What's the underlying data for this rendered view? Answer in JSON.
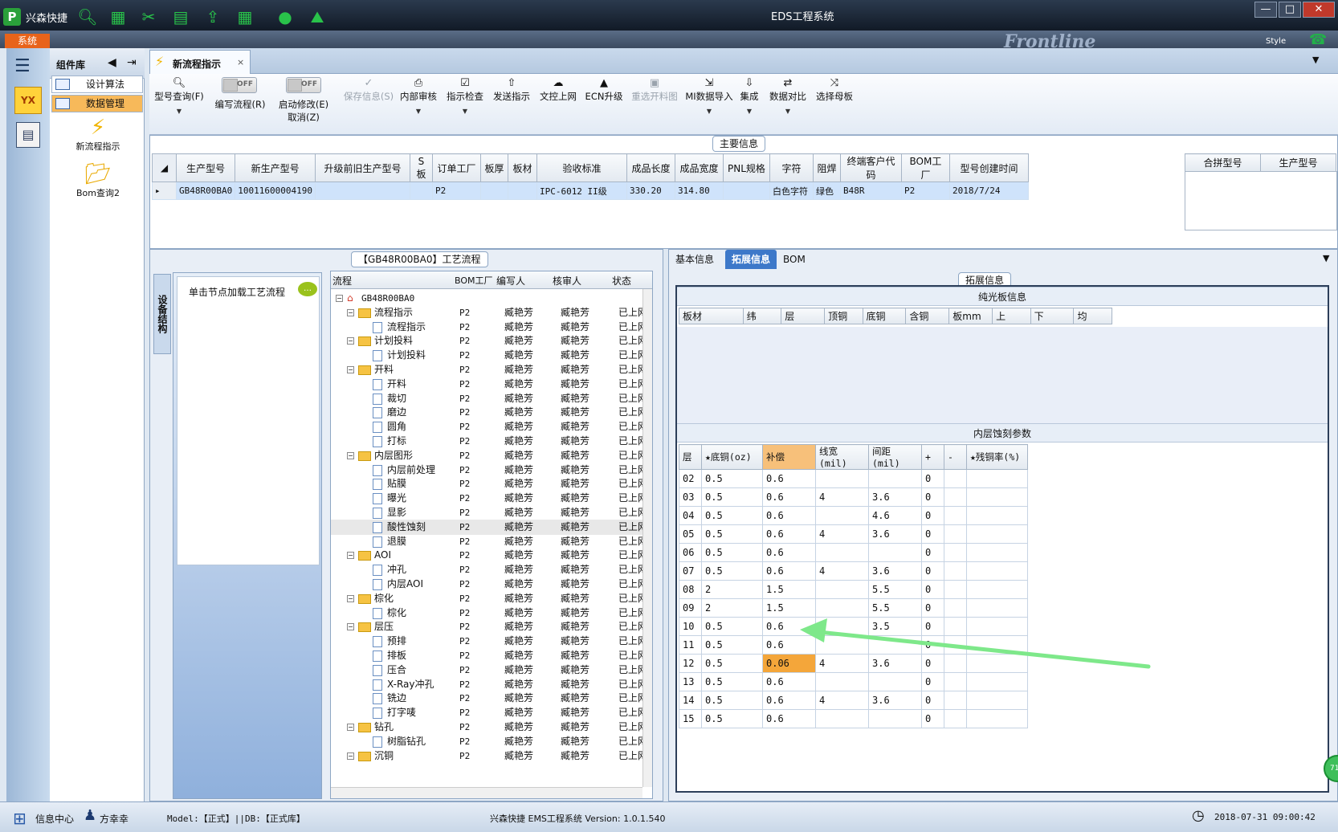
{
  "titlebar": {
    "app_name": "兴森快捷",
    "title": "EDS工程系统",
    "min": "—",
    "max": "□",
    "close": "✕"
  },
  "menubar": {
    "system_tab": "系统",
    "brand": "Frontline",
    "style_label": "Style"
  },
  "leftnav": {
    "yx": "YX"
  },
  "component_library": {
    "title": "组件库",
    "items": [
      {
        "label": "设计算法"
      },
      {
        "label": "数据管理"
      }
    ],
    "tiles": [
      {
        "label": "新流程指示"
      },
      {
        "label": "Bom查询2"
      }
    ]
  },
  "doc_tab": {
    "label": "新流程指示",
    "close": "×"
  },
  "toolbar": {
    "model_query": "型号查询(F)",
    "edit_flow": "编写流程(R)",
    "start_edit": "启动修改(E)",
    "cancel": "取消(Z)",
    "save_info": "保存信息(S)",
    "internal_review": "内部审核",
    "instruction_check": "指示检查",
    "send_instruction": "发送指示",
    "doc_control_upload": "文控上网",
    "ecn_upgrade": "ECN升级",
    "reselect_drawing": "重选开料图",
    "mi_import": "MI数据导入",
    "integrate": "集成",
    "data_compare": "数据对比",
    "select_mother": "选择母板",
    "toggle_off": "OFF"
  },
  "main_info": {
    "title": "主要信息",
    "columns": [
      "生产型号",
      "新生产型号",
      "升级前旧生产型号",
      "S板",
      "订单工厂",
      "板厚",
      "板材",
      "验收标准",
      "成品长度",
      "成品宽度",
      "PNL规格",
      "字符",
      "阻焊",
      "终端客户代码",
      "BOM工厂",
      "型号创建时间"
    ],
    "row": [
      "GB48R00BA0",
      "10011600004190",
      "",
      "",
      "P2",
      "",
      "",
      "IPC-6012 II级",
      "330.20",
      "314.80",
      "",
      "白色字符",
      "绿色",
      "B48R",
      "P2",
      "2018/7/24"
    ],
    "merge_columns": [
      "合拼型号",
      "生产型号"
    ]
  },
  "flow": {
    "title": "【GB48R00BA0】工艺流程",
    "vertical_tab": "设备结构",
    "click_hint": "单击节点加载工艺流程",
    "columns": [
      "流程",
      "BOM工厂",
      "编写人",
      "核审人",
      "状态"
    ],
    "root": "GB48R00BA0",
    "rows": [
      {
        "name": "流程指示",
        "level": 1,
        "folder": true,
        "factory": "P2",
        "writer": "臧艳芳",
        "reviewer": "臧艳芳",
        "status": "已上网"
      },
      {
        "name": "流程指示",
        "level": 2,
        "folder": false,
        "factory": "P2",
        "writer": "臧艳芳",
        "reviewer": "臧艳芳",
        "status": "已上网"
      },
      {
        "name": "计划投料",
        "level": 1,
        "folder": true,
        "factory": "P2",
        "writer": "臧艳芳",
        "reviewer": "臧艳芳",
        "status": "已上网"
      },
      {
        "name": "计划投料",
        "level": 2,
        "folder": false,
        "factory": "P2",
        "writer": "臧艳芳",
        "reviewer": "臧艳芳",
        "status": "已上网"
      },
      {
        "name": "开料",
        "level": 1,
        "folder": true,
        "factory": "P2",
        "writer": "臧艳芳",
        "reviewer": "臧艳芳",
        "status": "已上网"
      },
      {
        "name": "开料",
        "level": 2,
        "folder": false,
        "factory": "P2",
        "writer": "臧艳芳",
        "reviewer": "臧艳芳",
        "status": "已上网"
      },
      {
        "name": "裁切",
        "level": 2,
        "folder": false,
        "factory": "P2",
        "writer": "臧艳芳",
        "reviewer": "臧艳芳",
        "status": "已上网"
      },
      {
        "name": "磨边",
        "level": 2,
        "folder": false,
        "factory": "P2",
        "writer": "臧艳芳",
        "reviewer": "臧艳芳",
        "status": "已上网"
      },
      {
        "name": "圆角",
        "level": 2,
        "folder": false,
        "factory": "P2",
        "writer": "臧艳芳",
        "reviewer": "臧艳芳",
        "status": "已上网"
      },
      {
        "name": "打标",
        "level": 2,
        "folder": false,
        "factory": "P2",
        "writer": "臧艳芳",
        "reviewer": "臧艳芳",
        "status": "已上网"
      },
      {
        "name": "内层图形",
        "level": 1,
        "folder": true,
        "factory": "P2",
        "writer": "臧艳芳",
        "reviewer": "臧艳芳",
        "status": "已上网"
      },
      {
        "name": "内层前处理",
        "level": 2,
        "folder": false,
        "factory": "P2",
        "writer": "臧艳芳",
        "reviewer": "臧艳芳",
        "status": "已上网"
      },
      {
        "name": "贴膜",
        "level": 2,
        "folder": false,
        "factory": "P2",
        "writer": "臧艳芳",
        "reviewer": "臧艳芳",
        "status": "已上网"
      },
      {
        "name": "曝光",
        "level": 2,
        "folder": false,
        "factory": "P2",
        "writer": "臧艳芳",
        "reviewer": "臧艳芳",
        "status": "已上网"
      },
      {
        "name": "显影",
        "level": 2,
        "folder": false,
        "factory": "P2",
        "writer": "臧艳芳",
        "reviewer": "臧艳芳",
        "status": "已上网"
      },
      {
        "name": "酸性蚀刻",
        "level": 2,
        "folder": false,
        "factory": "P2",
        "writer": "臧艳芳",
        "reviewer": "臧艳芳",
        "status": "已上网",
        "highlight": true
      },
      {
        "name": "退膜",
        "level": 2,
        "folder": false,
        "factory": "P2",
        "writer": "臧艳芳",
        "reviewer": "臧艳芳",
        "status": "已上网"
      },
      {
        "name": "AOI",
        "level": 1,
        "folder": true,
        "factory": "P2",
        "writer": "臧艳芳",
        "reviewer": "臧艳芳",
        "status": "已上网"
      },
      {
        "name": "冲孔",
        "level": 2,
        "folder": false,
        "factory": "P2",
        "writer": "臧艳芳",
        "reviewer": "臧艳芳",
        "status": "已上网"
      },
      {
        "name": "内层AOI",
        "level": 2,
        "folder": false,
        "factory": "P2",
        "writer": "臧艳芳",
        "reviewer": "臧艳芳",
        "status": "已上网"
      },
      {
        "name": "棕化",
        "level": 1,
        "folder": true,
        "factory": "P2",
        "writer": "臧艳芳",
        "reviewer": "臧艳芳",
        "status": "已上网"
      },
      {
        "name": "棕化",
        "level": 2,
        "folder": false,
        "factory": "P2",
        "writer": "臧艳芳",
        "reviewer": "臧艳芳",
        "status": "已上网"
      },
      {
        "name": "层压",
        "level": 1,
        "folder": true,
        "factory": "P2",
        "writer": "臧艳芳",
        "reviewer": "臧艳芳",
        "status": "已上网"
      },
      {
        "name": "预排",
        "level": 2,
        "folder": false,
        "factory": "P2",
        "writer": "臧艳芳",
        "reviewer": "臧艳芳",
        "status": "已上网"
      },
      {
        "name": "排板",
        "level": 2,
        "folder": false,
        "factory": "P2",
        "writer": "臧艳芳",
        "reviewer": "臧艳芳",
        "status": "已上网"
      },
      {
        "name": "压合",
        "level": 2,
        "folder": false,
        "factory": "P2",
        "writer": "臧艳芳",
        "reviewer": "臧艳芳",
        "status": "已上网"
      },
      {
        "name": "X-Ray冲孔",
        "level": 2,
        "folder": false,
        "factory": "P2",
        "writer": "臧艳芳",
        "reviewer": "臧艳芳",
        "status": "已上网"
      },
      {
        "name": "铣边",
        "level": 2,
        "folder": false,
        "factory": "P2",
        "writer": "臧艳芳",
        "reviewer": "臧艳芳",
        "status": "已上网"
      },
      {
        "name": "打字唛",
        "level": 2,
        "folder": false,
        "factory": "P2",
        "writer": "臧艳芳",
        "reviewer": "臧艳芳",
        "status": "已上网"
      },
      {
        "name": "钻孔",
        "level": 1,
        "folder": true,
        "factory": "P2",
        "writer": "臧艳芳",
        "reviewer": "臧艳芳",
        "status": "已上网"
      },
      {
        "name": "树脂钻孔",
        "level": 2,
        "folder": false,
        "factory": "P2",
        "writer": "臧艳芳",
        "reviewer": "臧艳芳",
        "status": "已上网"
      },
      {
        "name": "沉铜",
        "level": 1,
        "folder": true,
        "factory": "P2",
        "writer": "臧艳芳",
        "reviewer": "臧艳芳",
        "status": "已上网"
      }
    ]
  },
  "right": {
    "tabs": [
      "基本信息",
      "拓展信息",
      "BOM"
    ],
    "ext_title": "拓展信息",
    "copper_title": "纯光板信息",
    "copper_cols": [
      "板材",
      "纬",
      "层",
      "顶铜",
      "底铜",
      "含铜",
      "板mm",
      "上",
      "下",
      "均"
    ],
    "etch_title": "内层蚀刻参数",
    "etch_cols": [
      "层",
      "★底铜(oz)",
      "补偿",
      "线宽(mil)",
      "间距(mil)",
      "+",
      "-",
      "★残铜率(%)"
    ],
    "etch_rows": [
      [
        "02",
        "0.5",
        "0.6",
        "",
        "",
        "0",
        "",
        ""
      ],
      [
        "03",
        "0.5",
        "0.6",
        "4",
        "3.6",
        "0",
        "",
        ""
      ],
      [
        "04",
        "0.5",
        "0.6",
        "",
        "4.6",
        "0",
        "",
        ""
      ],
      [
        "05",
        "0.5",
        "0.6",
        "4",
        "3.6",
        "0",
        "",
        ""
      ],
      [
        "06",
        "0.5",
        "0.6",
        "",
        "",
        "0",
        "",
        ""
      ],
      [
        "07",
        "0.5",
        "0.6",
        "4",
        "3.6",
        "0",
        "",
        ""
      ],
      [
        "08",
        "2",
        "1.5",
        "",
        "5.5",
        "0",
        "",
        ""
      ],
      [
        "09",
        "2",
        "1.5",
        "",
        "5.5",
        "0",
        "",
        ""
      ],
      [
        "10",
        "0.5",
        "0.6",
        "4",
        "3.5",
        "0",
        "",
        ""
      ],
      [
        "11",
        "0.5",
        "0.6",
        "",
        "",
        "0",
        "",
        ""
      ],
      [
        "12",
        "0.5",
        "0.06",
        "4",
        "3.6",
        "0",
        "",
        ""
      ],
      [
        "13",
        "0.5",
        "0.6",
        "",
        "",
        "0",
        "",
        ""
      ],
      [
        "14",
        "0.5",
        "0.6",
        "4",
        "3.6",
        "0",
        "",
        ""
      ],
      [
        "15",
        "0.5",
        "0.6",
        "",
        "",
        "0",
        "",
        ""
      ]
    ]
  },
  "status": {
    "info_center": "信息中心",
    "user": "方幸幸",
    "model_db": "Model:【正式】||DB:【正式库】",
    "app_version": "兴森快捷 EMS工程系统 Version: 1.0.1.540",
    "datetime": "2018-07-31 09:00:42",
    "badge": "71"
  },
  "colors": {
    "accent": "#3d78c9",
    "highlight": "#f4a63a",
    "arrow": "#7ee88a",
    "system_tab": "#e8631a"
  }
}
